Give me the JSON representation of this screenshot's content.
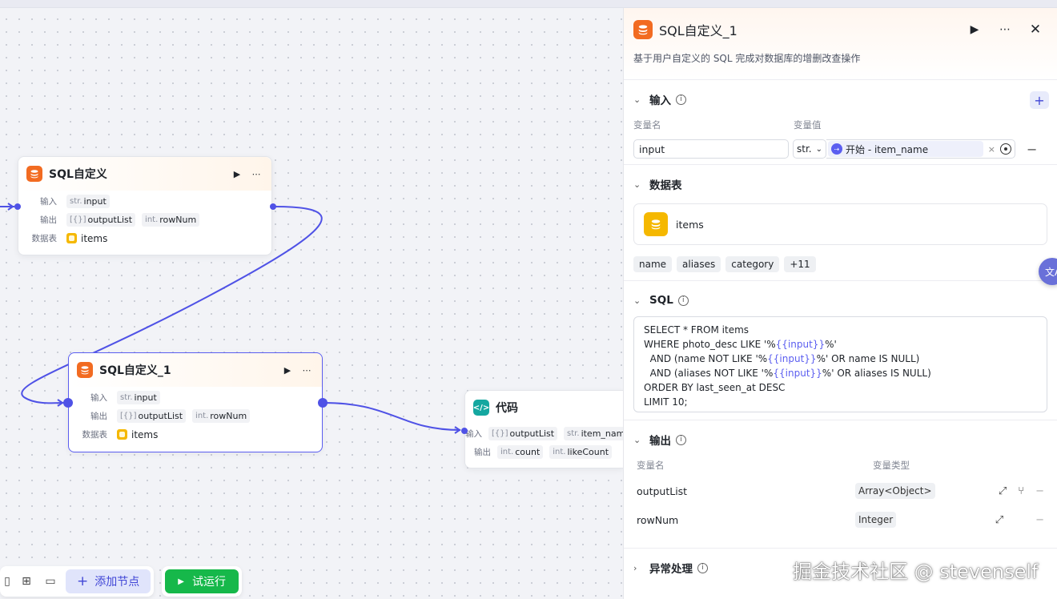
{
  "canvas": {
    "nodes": {
      "sql1": {
        "title": "SQL自定义",
        "input_label": "输入",
        "input_type": "str.",
        "input_name": "input",
        "output_label": "输出",
        "output_list_type": "[{}]",
        "output_list_name": "outputList",
        "rownum_type": "int.",
        "rownum_name": "rowNum",
        "table_label": "数据表",
        "table_name": "items"
      },
      "sql2": {
        "title": "SQL自定义_1",
        "input_label": "输入",
        "input_type": "str.",
        "input_name": "input",
        "output_label": "输出",
        "output_list_type": "[{}]",
        "output_list_name": "outputList",
        "rownum_type": "int.",
        "rownum_name": "rowNum",
        "table_label": "数据表",
        "table_name": "items"
      },
      "code": {
        "title": "代码",
        "input_label": "输入",
        "in1_type": "[{}]",
        "in1_name": "outputList",
        "in2_type": "str.",
        "in2_name": "item_name",
        "output_label": "输出",
        "out1_type": "int.",
        "out1_name": "count",
        "out2_type": "int.",
        "out2_name": "likeCount"
      }
    }
  },
  "toolbar": {
    "add_node_label": "添加节点",
    "run_label": "试运行"
  },
  "panel": {
    "title": "SQL自定义_1",
    "description": "基于用户自定义的 SQL 完成对数据库的增删改查操作",
    "input_section": {
      "title": "输入",
      "col_name": "变量名",
      "col_value": "变量值",
      "var_name": "input",
      "var_type": "str.",
      "ref_label": "开始 - item_name"
    },
    "table_section": {
      "title": "数据表",
      "table_name": "items",
      "columns": [
        "name",
        "aliases",
        "category",
        "+11"
      ]
    },
    "sql_section": {
      "title": "SQL",
      "line1": "SELECT * FROM items",
      "line2_a": "WHERE photo_desc LIKE '%",
      "line2_b": "%'",
      "line3_a": "  AND (name NOT LIKE '%",
      "line3_b": "%' OR name IS NULL)",
      "line4_a": "  AND (aliases NOT LIKE '%",
      "line4_b": "%' OR aliases IS NULL)",
      "line5": "ORDER BY last_seen_at DESC",
      "line6": "LIMIT 10;",
      "var": "{{input}}"
    },
    "output_section": {
      "title": "输出",
      "col_name": "变量名",
      "col_type": "变量类型",
      "rows": [
        {
          "name": "outputList",
          "type": "Array<Object>"
        },
        {
          "name": "rowNum",
          "type": "Integer"
        }
      ]
    },
    "error_section": {
      "title": "异常处理"
    }
  },
  "watermark": "掘金技术社区 @ stevenself",
  "colors": {
    "accent": "#4f52e6",
    "sql_icon": "#f26b21",
    "table_icon": "#f5b800",
    "code_icon": "#14a7a0",
    "run_button": "#16b84a"
  }
}
